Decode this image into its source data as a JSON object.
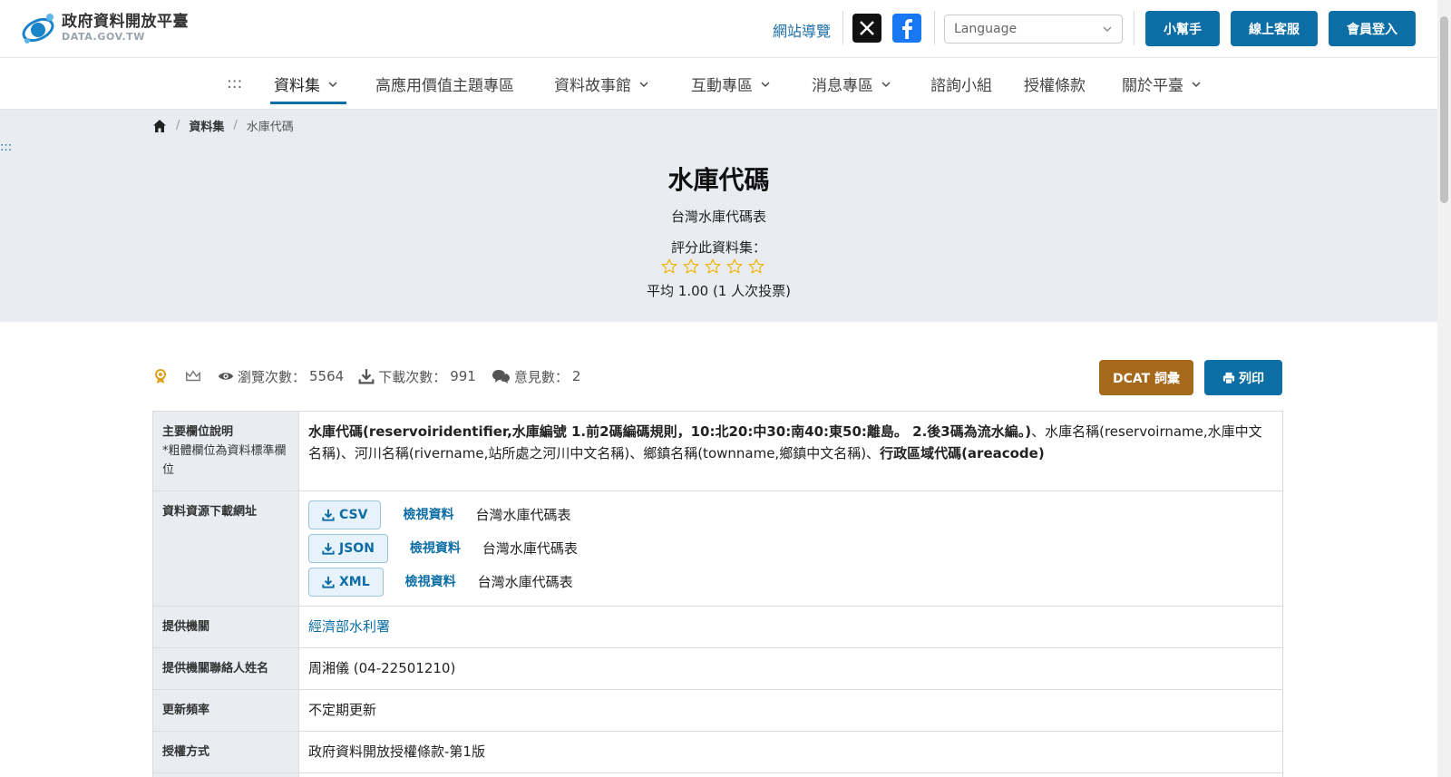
{
  "header": {
    "logo_cn": "政府資料開放平臺",
    "logo_en": "DATA.GOV.TW",
    "site_nav": "網站導覽",
    "language_placeholder": "Language",
    "btn_helper": "小幫手",
    "btn_service": "線上客服",
    "btn_login": "會員登入"
  },
  "nav": {
    "accesskey": ":::",
    "items": [
      {
        "label": "資料集",
        "has_dropdown": true,
        "active": true
      },
      {
        "label": "高應用價值主題專區",
        "has_dropdown": false
      },
      {
        "label": "資料故事館",
        "has_dropdown": true
      },
      {
        "label": "互動專區",
        "has_dropdown": true
      },
      {
        "label": "消息專區",
        "has_dropdown": true
      },
      {
        "label": "諮詢小組",
        "has_dropdown": false
      },
      {
        "label": "授權條款",
        "has_dropdown": false
      },
      {
        "label": "關於平臺",
        "has_dropdown": true
      }
    ]
  },
  "breadcrumb": {
    "home_icon": "home-icon",
    "level1": "資料集",
    "current": "水庫代碼"
  },
  "hero": {
    "accesskey": ":::",
    "title": "水庫代碼",
    "subtitle": "台灣水庫代碼表",
    "rate_label": "評分此資料集：",
    "rating": 0,
    "max_rating": 5,
    "average": "平均 1.00 (1 人次投票)"
  },
  "stats": {
    "views_label": "瀏覽次數：",
    "views": "5564",
    "downloads_label": "下載次數：",
    "downloads": "991",
    "comments_label": "意見數：",
    "comments": "2"
  },
  "actions": {
    "dcat": "DCAT 詞彙",
    "print": "列印"
  },
  "table": {
    "fields_label": "主要欄位說明",
    "fields_note": "*粗體欄位為資料標準欄位",
    "fields_bold1": "水庫代碼(reservoiridentifier,水庫編號 1.前2碼編碼規則，10:北20:中30:南40:東50:離島。 2.後3碼為流水編。)",
    "fields_plain": "、水庫名稱(reservoirname,水庫中文名稱)、河川名稱(rivername,站所處之河川中文名稱)、鄉鎮名稱(townname,鄉鎮中文名稱)、",
    "fields_bold2": "行政區域代碼(areacode)",
    "resources_label": "資料資源下載網址",
    "resources": [
      {
        "format": "CSV",
        "view": "檢視資料",
        "name": "台灣水庫代碼表"
      },
      {
        "format": "JSON",
        "view": "檢視資料",
        "name": "台灣水庫代碼表"
      },
      {
        "format": "XML",
        "view": "檢視資料",
        "name": "台灣水庫代碼表"
      }
    ],
    "agency_label": "提供機關",
    "agency": "經濟部水利署",
    "contact_label": "提供機關聯絡人姓名",
    "contact": "周湘儀 (04-22501210)",
    "frequency_label": "更新頻率",
    "frequency": "不定期更新",
    "license_label": "授權方式",
    "license": "政府資料開放授權條款-第1版"
  },
  "colors": {
    "primary": "#0d6ea6",
    "dcat": "#a6681a",
    "hero_bg": "#e9edf2",
    "star": "#f0b400"
  }
}
